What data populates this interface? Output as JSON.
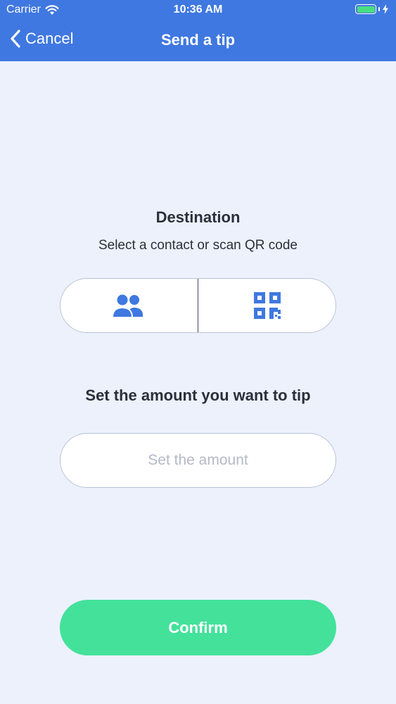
{
  "status_bar": {
    "carrier": "Carrier",
    "time": "10:36 AM",
    "battery_color": "#4ade80"
  },
  "nav": {
    "back_label": "Cancel",
    "title": "Send a tip",
    "back_icon": "chevron-left-icon",
    "background_color": "#3f78e0"
  },
  "destination": {
    "title": "Destination",
    "subtitle": "Select a contact or scan QR code",
    "options": [
      {
        "icon": "contacts-icon",
        "color": "#3f78e0"
      },
      {
        "icon": "qr-code-icon",
        "color": "#3f78e0"
      }
    ]
  },
  "amount": {
    "title": "Set the amount you want to tip",
    "placeholder": "Set the amount",
    "value": ""
  },
  "confirm": {
    "label": "Confirm",
    "color": "#44e19b"
  }
}
